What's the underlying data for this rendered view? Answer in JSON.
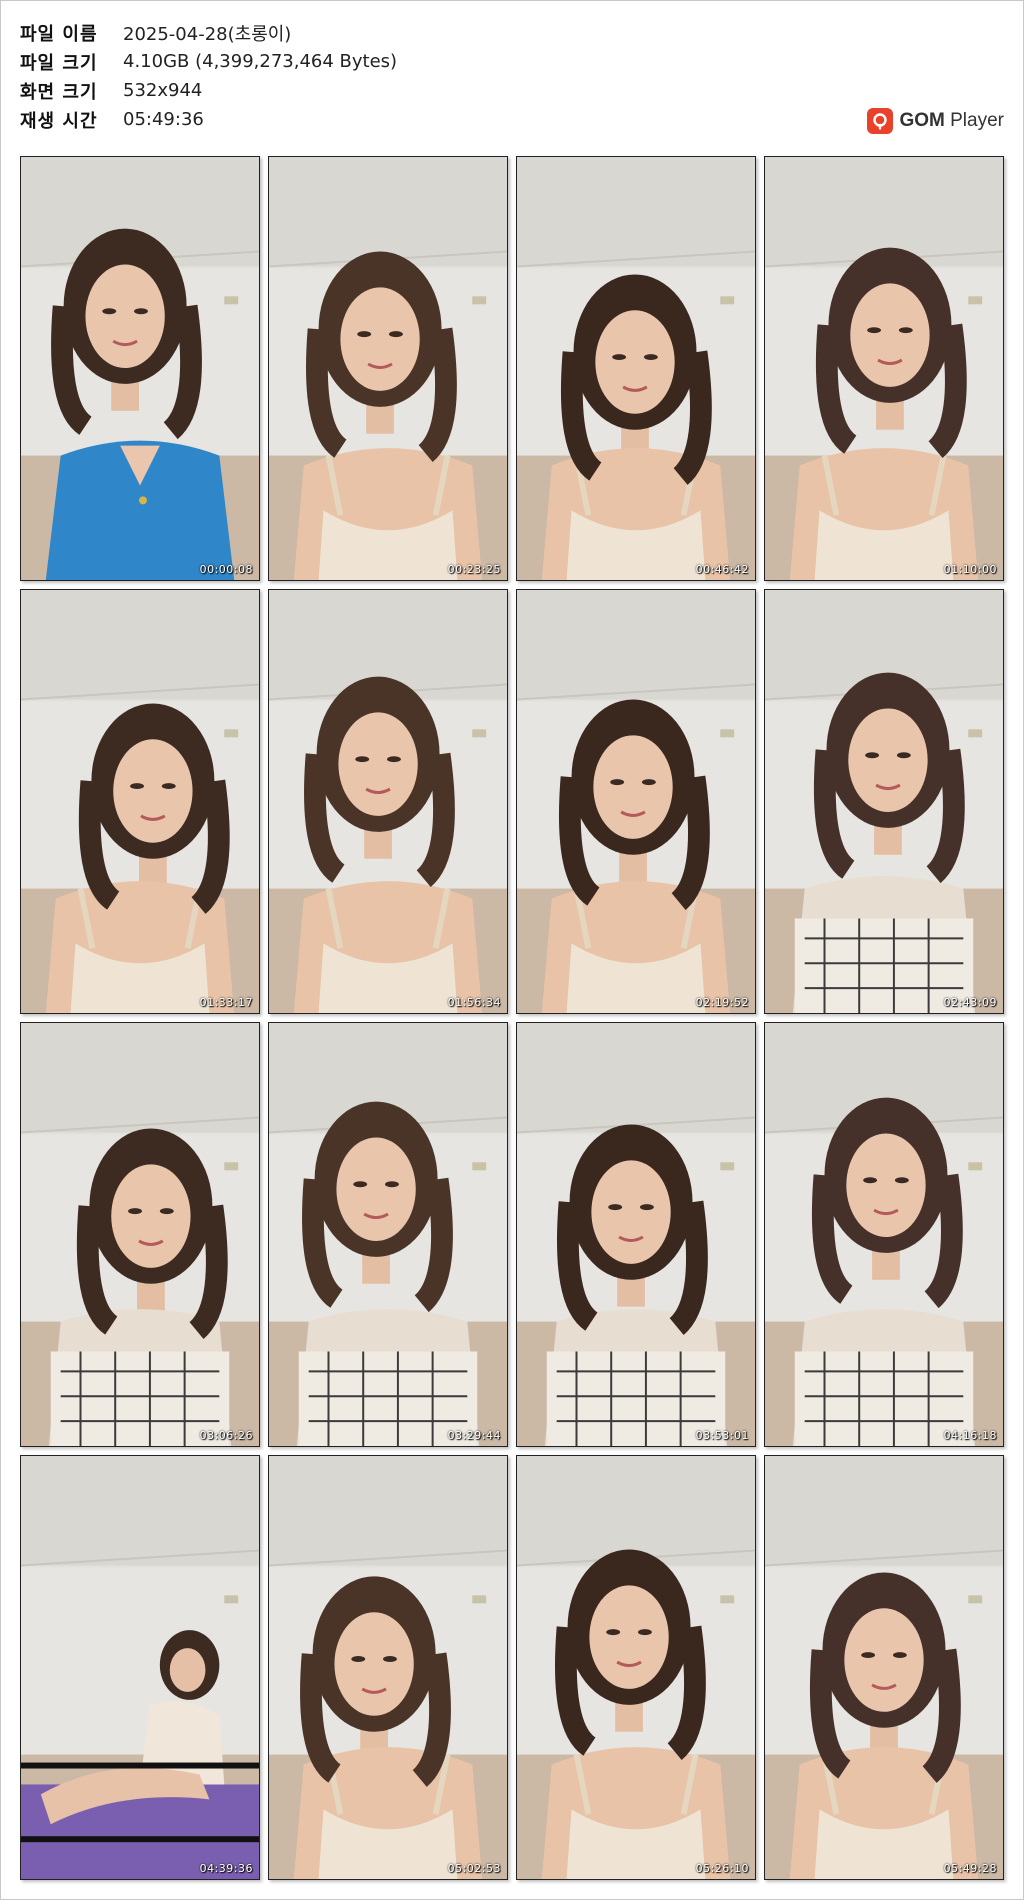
{
  "info": {
    "rows": [
      {
        "label": "파일 이름",
        "value": "2025-04-28(초롱이)"
      },
      {
        "label": "파일 크기",
        "value": "4.10GB (4,399,273,464 Bytes)"
      },
      {
        "label": "화면 크기",
        "value": "532x944"
      },
      {
        "label": "재생 시간",
        "value": "05:49:36"
      }
    ]
  },
  "logo": {
    "brand": "GOM",
    "product": " Player",
    "icon": "gom-player-logo-icon",
    "color": "#e8412c"
  },
  "thumbnails": [
    {
      "timestamp": "00:00:08",
      "top": "blue-vest"
    },
    {
      "timestamp": "00:23:25",
      "top": "cream-bra"
    },
    {
      "timestamp": "00:46:42",
      "top": "cream-bra"
    },
    {
      "timestamp": "01:10:00",
      "top": "cream-bra"
    },
    {
      "timestamp": "01:33:17",
      "top": "cream-bra"
    },
    {
      "timestamp": "01:56:34",
      "top": "cream-bra"
    },
    {
      "timestamp": "02:19:52",
      "top": "cream-bra"
    },
    {
      "timestamp": "02:43:09",
      "top": "checked-top"
    },
    {
      "timestamp": "03:06:26",
      "top": "checked-top"
    },
    {
      "timestamp": "03:29:44",
      "top": "checked-top"
    },
    {
      "timestamp": "03:53:01",
      "top": "checked-top"
    },
    {
      "timestamp": "04:16:18",
      "top": "checked-top"
    },
    {
      "timestamp": "04:39:36",
      "top": "seated-wide"
    },
    {
      "timestamp": "05:02:53",
      "top": "cream-bra"
    },
    {
      "timestamp": "05:26:10",
      "top": "cream-bra"
    },
    {
      "timestamp": "05:49:28",
      "top": "cream-bra"
    }
  ]
}
